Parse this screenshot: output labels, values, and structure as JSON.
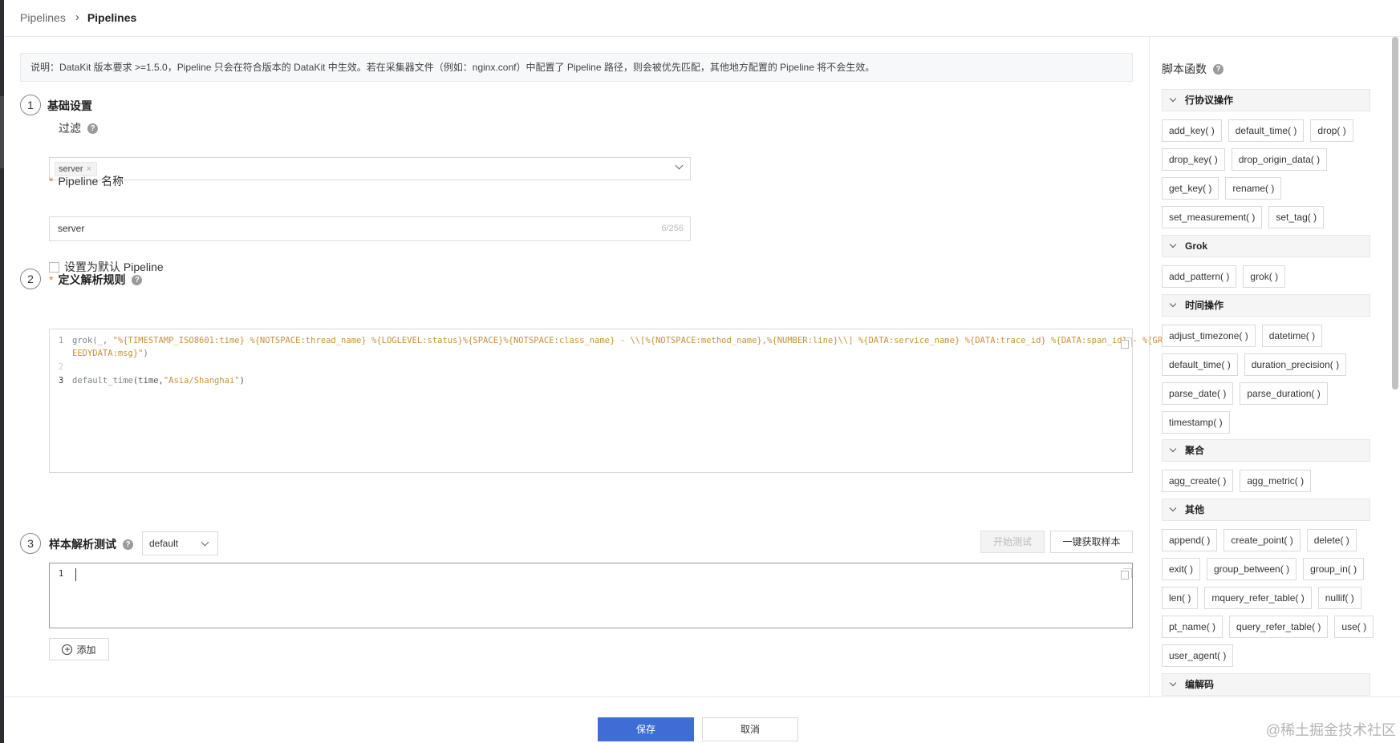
{
  "breadcrumb": {
    "root": "Pipelines",
    "current": "Pipelines"
  },
  "notice": "说明：DataKit 版本要求 >=1.5.0，Pipeline 只会在符合版本的 DataKit 中生效。若在采集器文件（例如：nginx.conf）中配置了 Pipeline 路径，则会被优先匹配，其他地方配置的 Pipeline 将不会生效。",
  "steps": [
    {
      "num": "1",
      "title": "基础设置"
    },
    {
      "num": "2",
      "title": "定义解析规则"
    },
    {
      "num": "3",
      "title": "样本解析测试"
    }
  ],
  "basic": {
    "filter_label": "过滤",
    "filter_tag": "server",
    "name_label": "Pipeline 名称",
    "name_value": "server",
    "name_counter": "6/256",
    "default_checkbox_label": "设置为默认 Pipeline"
  },
  "code": {
    "line_numbers": [
      "1",
      "2",
      "3"
    ],
    "line1_fn": "grok(_, ",
    "line1_str": "\"%{TIMESTAMP_ISO8601:time} %{NOTSPACE:thread_name} %{LOGLEVEL:status}%{SPACE}%{NOTSPACE:class_name} - \\\\[%{NOTSPACE:method_name},%{NUMBER:line}\\\\] %{DATA:service_name} %{DATA:trace_id} %{DATA:span_id} - %{GR",
    "line1b_str": "EEDYDATA:msg}\"",
    "line1b_end": ")",
    "line3_fn": "default_time",
    "line3_args": "(time,",
    "line3_str": "\"Asia/Shanghai\"",
    "line3_end": ")"
  },
  "test": {
    "sample_select": "default",
    "start_button": "开始测试",
    "fetch_button": "一键获取样本",
    "line_number": "1",
    "add_button": "添加"
  },
  "footer": {
    "save": "保存",
    "cancel": "取消",
    "watermark": "@稀土掘金技术社区"
  },
  "panel": {
    "title": "脚本函数",
    "groups": [
      {
        "name": "行协议操作",
        "items": [
          "add_key( )",
          "default_time( )",
          "drop( )",
          "drop_key( )",
          "drop_origin_data( )",
          "get_key( )",
          "rename( )",
          "set_measurement( )",
          "set_tag( )"
        ]
      },
      {
        "name": "Grok",
        "items": [
          "add_pattern( )",
          "grok( )"
        ]
      },
      {
        "name": "时间操作",
        "items": [
          "adjust_timezone( )",
          "datetime( )",
          "default_time( )",
          "duration_precision( )",
          "parse_date( )",
          "parse_duration( )",
          "timestamp( )"
        ]
      },
      {
        "name": "聚合",
        "items": [
          "agg_create( )",
          "agg_metric( )"
        ]
      },
      {
        "name": "其他",
        "items": [
          "append( )",
          "create_point( )",
          "delete( )",
          "exit( )",
          "group_between( )",
          "group_in( )",
          "len( )",
          "mquery_refer_table( )",
          "nullif( )",
          "pt_name( )",
          "query_refer_table( )",
          "use( )",
          "user_agent( )"
        ]
      },
      {
        "name": "编解码",
        "items": []
      }
    ]
  }
}
